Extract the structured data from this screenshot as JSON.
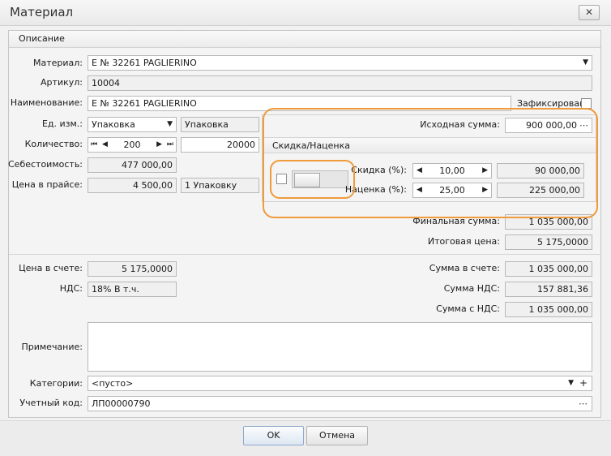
{
  "window": {
    "title": "Материал",
    "close_glyph": "✕"
  },
  "section": {
    "title": "Описание"
  },
  "material": {
    "label": "Материал:",
    "value": "Е № 32261 PAGLIERINO",
    "icon": "dropdown-arrow-icon"
  },
  "article": {
    "label": "Артикул:",
    "value": "10004"
  },
  "name": {
    "label": "Наименование:",
    "value": "Е № 32261 PAGLIERINO",
    "fixed_label": "Зафиксирован"
  },
  "unit": {
    "label": "Ед. изм.:",
    "value": "Упаковка",
    "display": "Упаковка"
  },
  "quantity": {
    "label": "Количество:",
    "value": "200",
    "total": "20000"
  },
  "cost": {
    "label": "Себестоимость:",
    "value": "477 000,00"
  },
  "price_list": {
    "label": "Цена в прайсе:",
    "value": "4 500,00",
    "unit": "1 Упаковку"
  },
  "source_sum": {
    "label": "Исходная сумма:",
    "value": "900 000,00"
  },
  "discount_group": {
    "title": "Скидка/Наценка",
    "discount_label": "Скидка (%):",
    "discount_value": "10,00",
    "discount_sum": "90 000,00",
    "markup_label": "Наценка (%):",
    "markup_value": "25,00",
    "markup_sum": "225 000,00"
  },
  "final_sum": {
    "label": "Финальная сумма:",
    "value": "1 035 000,00"
  },
  "total_price": {
    "label": "Итоговая цена:",
    "value": "5 175,0000"
  },
  "invoice_price": {
    "label": "Цена в счете:",
    "value": "5 175,0000"
  },
  "vat": {
    "label": "НДС:",
    "value": "18% В т.ч."
  },
  "invoice_sum": {
    "label": "Сумма в счете:",
    "value": "1 035 000,00"
  },
  "vat_sum": {
    "label": "Сумма НДС:",
    "value": "157 881,36"
  },
  "sum_with_vat": {
    "label": "Сумма с НДС:",
    "value": "1 035 000,00"
  },
  "note": {
    "label": "Примечание:",
    "value": ""
  },
  "categories": {
    "label": "Категории:",
    "value": "<пусто>",
    "add_glyph": "+"
  },
  "account_code": {
    "label": "Учетный код:",
    "value": "ЛП00000790"
  },
  "buttons": {
    "ok": "OK",
    "cancel": "Отмена"
  },
  "colors": {
    "highlight": "#ef9a3c",
    "field_border": "#b8b8b8",
    "readonly_bg": "#f0f0f0"
  }
}
